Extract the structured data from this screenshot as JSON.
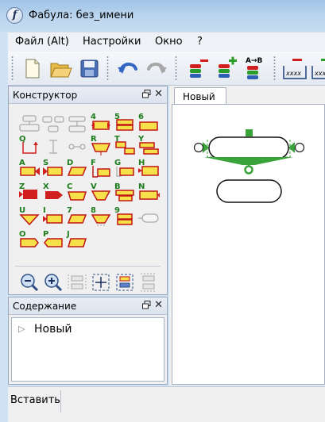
{
  "window": {
    "title": "Фабула: без_имени",
    "app_icon_letter": "f"
  },
  "menu": [
    {
      "label": "Файл (Alt)"
    },
    {
      "label": "Настройки"
    },
    {
      "label": "Окно"
    },
    {
      "label": "?"
    }
  ],
  "toolbar": {
    "buttons": [
      "new-file",
      "open-folder",
      "save",
      "undo",
      "redo",
      "remove-block",
      "add-block",
      "rename-a-to-b",
      "remove-text",
      "add-text"
    ],
    "rename_label": "A→B",
    "text_field_label": "xxxx"
  },
  "constructor_panel": {
    "title": "Конструктор",
    "palette_labels": [
      "4",
      "5",
      "6",
      "Q",
      "R",
      "T",
      "Y",
      "A",
      "S",
      "D",
      "F",
      "G",
      "H",
      "Z",
      "X",
      "C",
      "V",
      "B",
      "N",
      "U",
      "I",
      "7",
      "8",
      "9",
      "O",
      "P",
      "J"
    ]
  },
  "contents_panel": {
    "title": "Содержание",
    "tree": [
      {
        "label": "Новый"
      }
    ]
  },
  "editor": {
    "tab_label": "Новый"
  },
  "status": {
    "text": "Вставить"
  },
  "colors": {
    "accent_green": "#3aa43a",
    "block_red": "#d11e1e",
    "block_yellow": "#f6e14a",
    "block_blue": "#2f5fb3"
  }
}
